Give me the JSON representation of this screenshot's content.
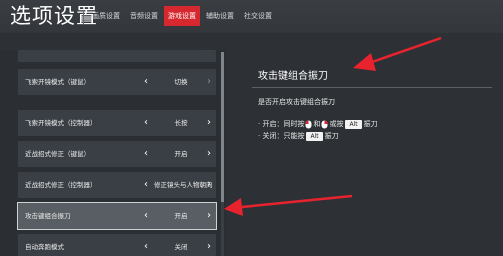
{
  "header": {
    "title": "选项设置",
    "tabs": [
      {
        "label": "画质设置",
        "active": false
      },
      {
        "label": "音频设置",
        "active": false
      },
      {
        "label": "游戏设置",
        "active": true
      },
      {
        "label": "辅助设置",
        "active": false
      },
      {
        "label": "社交设置",
        "active": false
      }
    ]
  },
  "settings_list": {
    "rows": [
      {
        "label": "",
        "value": "",
        "selected": false,
        "next_enabled": true
      },
      {
        "label": "飞索开镜模式（键鼠）",
        "value": "切换",
        "selected": false,
        "next_enabled": false
      },
      {
        "label": "飞索开镜模式（控制器）",
        "value": "长按",
        "selected": false,
        "next_enabled": true
      },
      {
        "label": "近战招式修正（键鼠）",
        "value": "开启",
        "selected": false,
        "next_enabled": true
      },
      {
        "label": "近战招式修正（控制器）",
        "value": "修正镜头与人物朝向",
        "selected": false,
        "next_enabled": true
      },
      {
        "label": "攻击键组合振刀",
        "value": "开启",
        "selected": true,
        "next_enabled": true
      },
      {
        "label": "自动奔跑模式",
        "value": "关闭",
        "selected": false,
        "next_enabled": true
      }
    ]
  },
  "detail": {
    "title": "攻击键组合振刀",
    "question": "是否开启攻击键组合振刀",
    "on_prefix": "· 开启：同时按",
    "on_and": "和",
    "on_or": "或按",
    "on_key": "Alt",
    "on_suffix": "振刀",
    "off_prefix": "· 关闭：只能按",
    "off_key": "Alt",
    "off_suffix": "振刀"
  },
  "colors": {
    "accent": "#d7282f",
    "annotation_arrow": "#e8232e"
  }
}
